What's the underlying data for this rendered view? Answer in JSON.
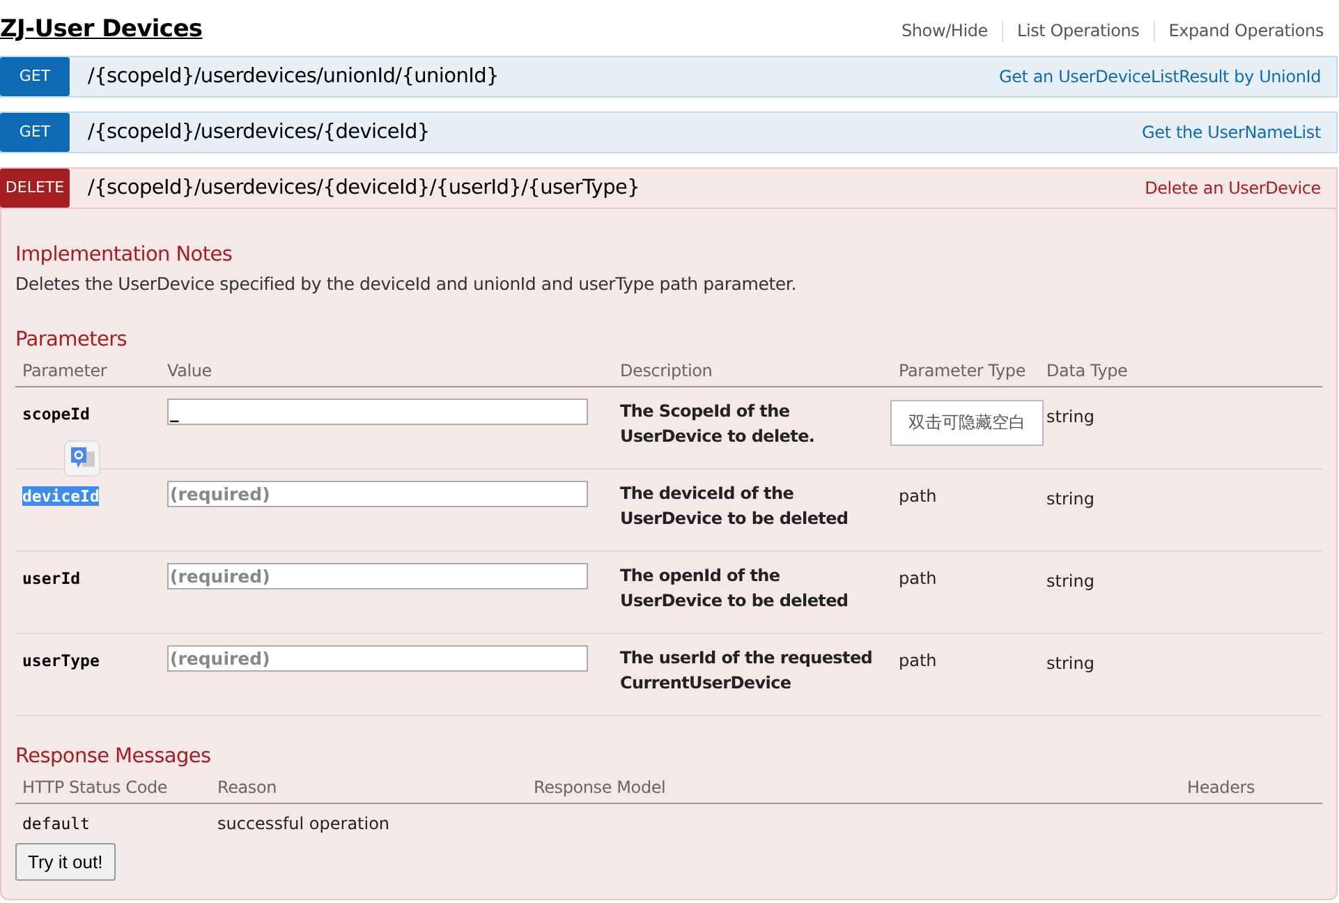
{
  "title": "ZJ-User Devices",
  "header_links": [
    "Show/Hide",
    "List Operations",
    "Expand Operations"
  ],
  "operations": [
    {
      "method": "GET",
      "path": "/{scopeId}/userdevices/unionId/{unionId}",
      "summary": "Get an UserDeviceListResult by UnionId"
    },
    {
      "method": "GET",
      "path": "/{scopeId}/userdevices/{deviceId}",
      "summary": "Get the UserNameList"
    },
    {
      "method": "DELETE",
      "path": "/{scopeId}/userdevices/{deviceId}/{userId}/{userType}",
      "summary": "Delete an UserDevice",
      "details": {
        "notes_title": "Implementation Notes",
        "notes": "Deletes the UserDevice specified by the deviceId and unionId and userType path parameter.",
        "params_title": "Parameters",
        "param_columns": [
          "Parameter",
          "Value",
          "Description",
          "Parameter Type",
          "Data Type"
        ],
        "params": [
          {
            "name": "scopeId",
            "text_selected": false,
            "value": "_",
            "description": "The ScopeId of the UserDevice to delete.",
            "data_type": "string"
          },
          {
            "name": "deviceId",
            "text_selected": true,
            "placeholder": "(required)",
            "description": "The deviceId of the UserDevice to be deleted",
            "param_type": "path",
            "data_type": "string"
          },
          {
            "name": "userId",
            "text_selected": false,
            "placeholder": "(required)",
            "description": "The openId of the UserDevice to be deleted",
            "param_type": "path",
            "data_type": "string"
          },
          {
            "name": "userType",
            "text_selected": false,
            "placeholder": "(required)",
            "description": "The userId of the requested CurrentUserDevice",
            "param_type": "path",
            "data_type": "string"
          }
        ],
        "responses_title": "Response Messages",
        "response_columns": [
          "HTTP Status Code",
          "Reason",
          "Response Model",
          "Headers"
        ],
        "responses": [
          {
            "code": "default",
            "reason": "successful operation"
          }
        ],
        "button": "Try it out!",
        "tooltip": "双击可隐藏空白"
      }
    }
  ]
}
